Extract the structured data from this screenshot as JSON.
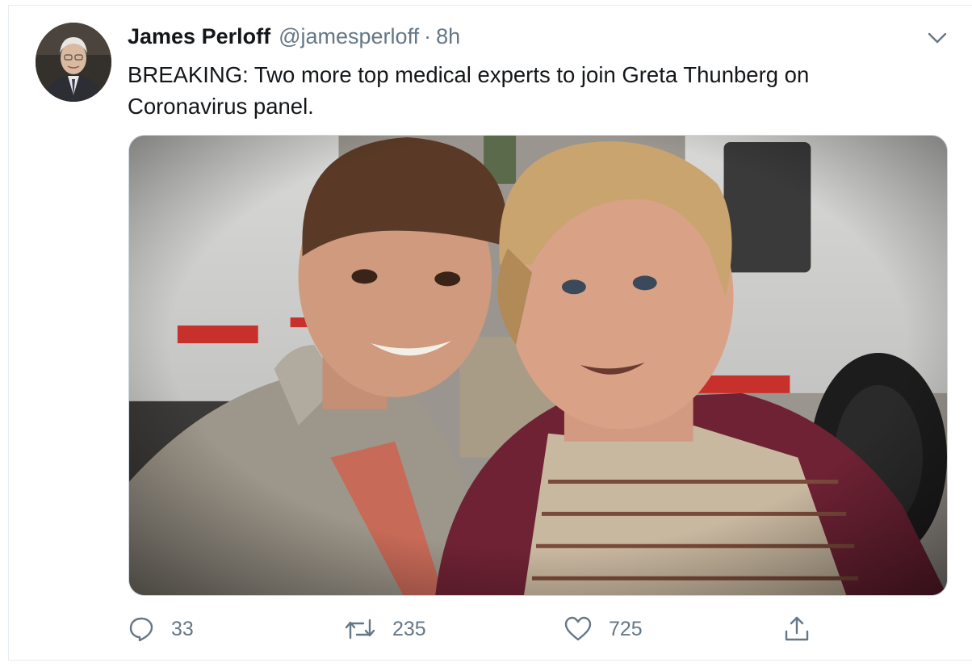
{
  "tweet": {
    "author_name": "James Perloff",
    "author_handle": "@jamesperloff",
    "separator": "·",
    "time": "8h",
    "text": "BREAKING: Two more top medical experts to join Greta Thunberg on Coronavirus panel.",
    "menu_icon": "chevron-down-icon",
    "avatar_icon": "profile-photo"
  },
  "media": {
    "description_icon": "photo-of-two-men"
  },
  "actions": {
    "reply_count": "33",
    "retweet_count": "235",
    "like_count": "725",
    "reply_icon": "reply-icon",
    "retweet_icon": "retweet-icon",
    "like_icon": "heart-icon",
    "share_icon": "share-icon"
  },
  "colors": {
    "text": "#14171a",
    "secondary": "#657786",
    "border": "#e6ecf0"
  }
}
